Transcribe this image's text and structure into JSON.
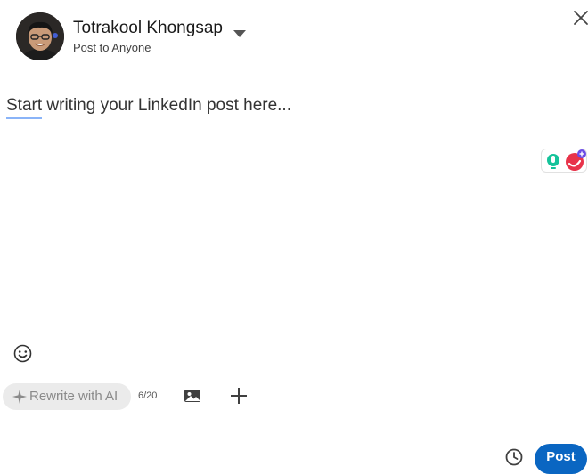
{
  "composer": {
    "author_name": "Totrakool Khongsap",
    "audience_label": "Post to Anyone",
    "placeholder": "Start writing your LinkedIn post here..."
  },
  "icons": {
    "close": "close-icon",
    "caret": "caret-down-icon",
    "emoji": "emoji-icon",
    "sparkle": "sparkle-icon",
    "image": "image-icon",
    "plus": "plus-icon",
    "clock": "clock-icon",
    "grammarly": "grammarly-icon"
  },
  "toolbar": {
    "ai_label": "Rewrite with AI",
    "ai_counter": "6/20"
  },
  "footer": {
    "post_label": "Post"
  },
  "colors": {
    "primary": "#0a66c2",
    "ai_bg": "#ebebeb",
    "ai_text": "#8a8a8a"
  }
}
